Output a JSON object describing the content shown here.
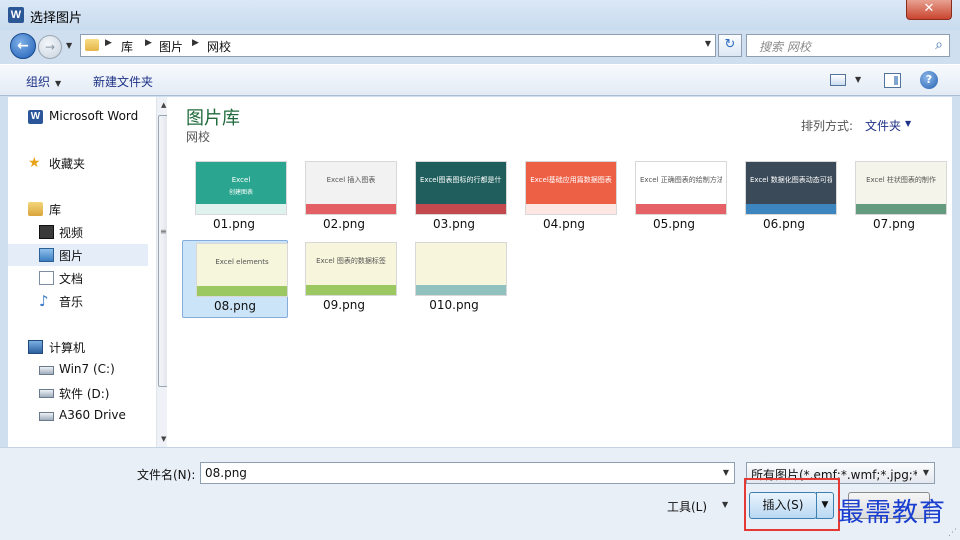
{
  "window": {
    "title": "选择图片",
    "app_icon": "W",
    "close": "✕"
  },
  "nav": {
    "back_glyph": "←",
    "forward_glyph": "→",
    "breadcrumbs": [
      "库",
      "图片",
      "网校"
    ],
    "search_placeholder": "搜索 网校",
    "refresh_glyph": "↻"
  },
  "toolbar": {
    "organize": "组织",
    "new_folder": "新建文件夹",
    "help": "?"
  },
  "sidebar": {
    "favorites": [
      {
        "label": "Microsoft Word",
        "icon": "word-icon"
      },
      {
        "label": "收藏夹",
        "icon": "star-icon"
      }
    ],
    "libraries_label": "库",
    "libraries": [
      {
        "label": "视频",
        "icon": "video-icon"
      },
      {
        "label": "图片",
        "icon": "pictures-icon",
        "selected": true
      },
      {
        "label": "文档",
        "icon": "document-icon"
      },
      {
        "label": "音乐",
        "icon": "music-icon"
      }
    ],
    "computer_label": "计算机",
    "drives": [
      {
        "label": "Win7 (C:)",
        "icon": "drive-icon"
      },
      {
        "label": "软件 (D:)",
        "icon": "drive-icon"
      },
      {
        "label": "A360 Drive",
        "icon": "cloud-drive-icon"
      }
    ]
  },
  "main": {
    "library_title": "图片库",
    "library_subtitle": "网校",
    "arrange_label": "排列方式:",
    "arrange_value": "文件夹"
  },
  "files": [
    {
      "name": "01.png",
      "caption": "Excel",
      "subcaption": "创建图表",
      "bg": "#2aa58f",
      "accent": "#ffffff"
    },
    {
      "name": "02.png",
      "caption": "Excel 插入图表",
      "subcaption": "",
      "bg": "#f2f2f2",
      "accent": "#e2454b"
    },
    {
      "name": "03.png",
      "caption": "Excel图表图标的行都是什么",
      "subcaption": "",
      "bg": "#1f5e5c",
      "accent": "#e2454b"
    },
    {
      "name": "04.png",
      "caption": "Excel基础应用篇数据图表",
      "subcaption": "",
      "bg": "#ee6046",
      "accent": "#ffffff"
    },
    {
      "name": "05.png",
      "caption": "Excel 正确图表的绘制方法",
      "subcaption": "",
      "bg": "#ffffff",
      "accent": "#e2454b"
    },
    {
      "name": "06.png",
      "caption": "Excel 数据化图表动态可视",
      "subcaption": "",
      "bg": "#3a4a58",
      "accent": "#3e8fd0"
    },
    {
      "name": "07.png",
      "caption": "Excel 柱状图表的制作",
      "subcaption": "",
      "bg": "#f4f4ea",
      "accent": "#4a8a6a"
    },
    {
      "name": "08.png",
      "caption": "Excel elements",
      "subcaption": "",
      "bg": "#f5f6dc",
      "accent": "#8bbf4a",
      "selected": true
    },
    {
      "name": "09.png",
      "caption": "Excel 图表的数据标签",
      "subcaption": "",
      "bg": "#f7f6dc",
      "accent": "#8bbf4a"
    },
    {
      "name": "010.png",
      "caption": "",
      "subcaption": "",
      "bg": "#f7f6dc",
      "accent": "#7fb7b8"
    }
  ],
  "footer": {
    "filename_label": "文件名(N):",
    "filename_value": "08.png",
    "filetype_value": "所有图片(*.emf;*.wmf;*.jpg;*.jpeg;*.jfif;*.jpe;*.png)",
    "tools_label": "工具(L)",
    "insert_label": "插入(S)",
    "watermark": "最需教育"
  }
}
